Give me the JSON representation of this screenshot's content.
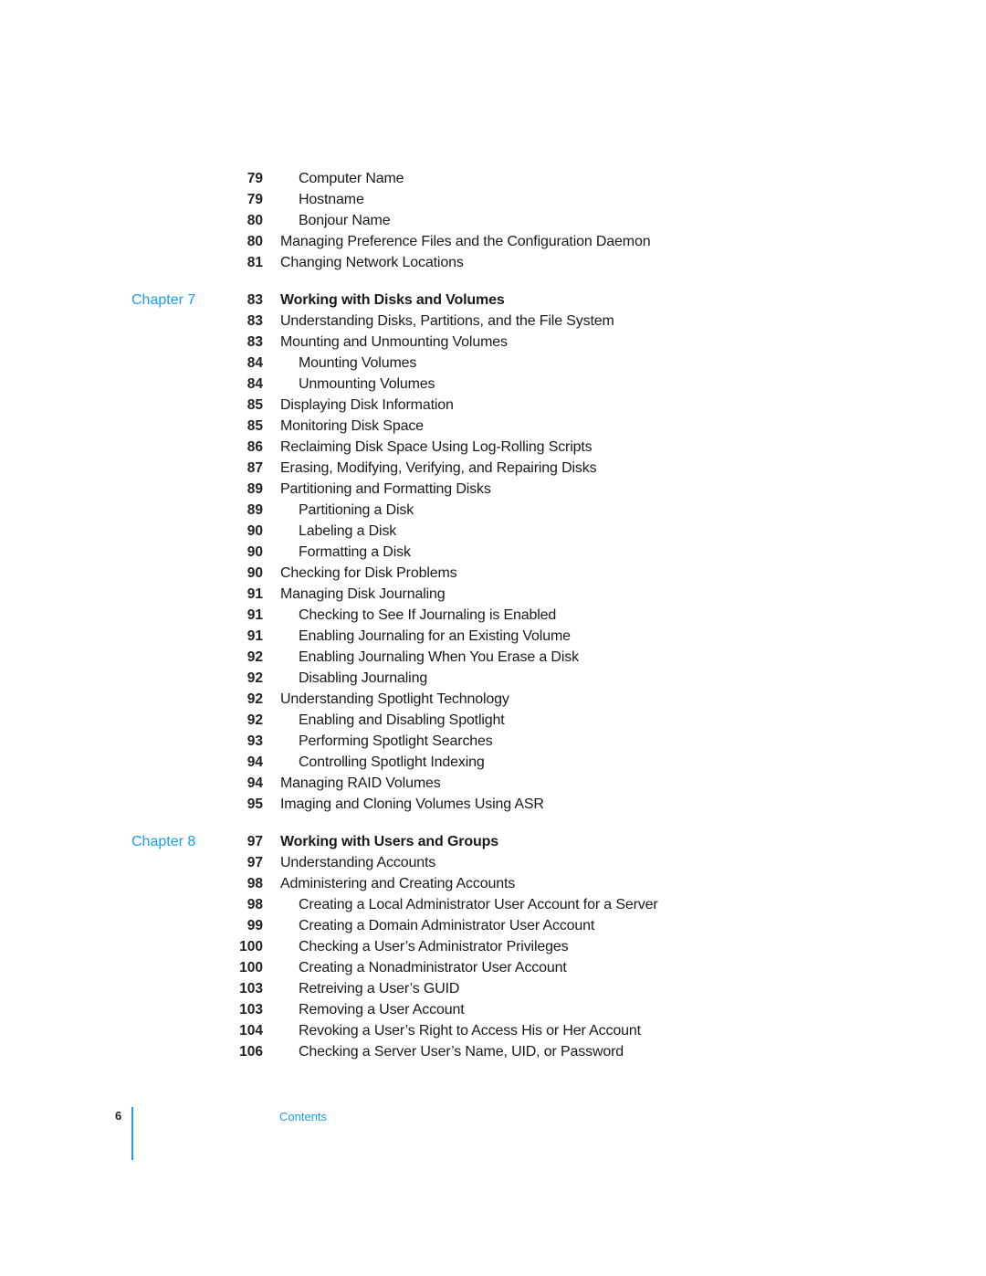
{
  "toc": {
    "entries": [
      {
        "page": "79",
        "title": "Computer Name",
        "level": 2
      },
      {
        "page": "79",
        "title": "Hostname",
        "level": 2
      },
      {
        "page": "80",
        "title": "Bonjour Name",
        "level": 2
      },
      {
        "page": "80",
        "title": "Managing Preference Files and the Configuration Daemon",
        "level": 1
      },
      {
        "page": "81",
        "title": "Changing Network Locations",
        "level": 1
      },
      {
        "chapter": "Chapter 7",
        "page": "83",
        "title": "Working with Disks and Volumes",
        "level": 0
      },
      {
        "page": "83",
        "title": "Understanding Disks, Partitions, and the File System",
        "level": 1
      },
      {
        "page": "83",
        "title": "Mounting and Unmounting Volumes",
        "level": 1
      },
      {
        "page": "84",
        "title": "Mounting Volumes",
        "level": 2
      },
      {
        "page": "84",
        "title": "Unmounting Volumes",
        "level": 2
      },
      {
        "page": "85",
        "title": "Displaying Disk Information",
        "level": 1
      },
      {
        "page": "85",
        "title": "Monitoring Disk Space",
        "level": 1
      },
      {
        "page": "86",
        "title": "Reclaiming Disk Space Using Log-Rolling Scripts",
        "level": 1
      },
      {
        "page": "87",
        "title": "Erasing, Modifying, Verifying, and Repairing Disks",
        "level": 1
      },
      {
        "page": "89",
        "title": "Partitioning and Formatting Disks",
        "level": 1
      },
      {
        "page": "89",
        "title": "Partitioning a Disk",
        "level": 2
      },
      {
        "page": "90",
        "title": "Labeling a Disk",
        "level": 2
      },
      {
        "page": "90",
        "title": "Formatting a Disk",
        "level": 2
      },
      {
        "page": "90",
        "title": "Checking for Disk Problems",
        "level": 1
      },
      {
        "page": "91",
        "title": "Managing Disk Journaling",
        "level": 1
      },
      {
        "page": "91",
        "title": "Checking to See If Journaling is Enabled",
        "level": 2
      },
      {
        "page": "91",
        "title": "Enabling Journaling for an Existing Volume",
        "level": 2
      },
      {
        "page": "92",
        "title": "Enabling Journaling When You Erase a Disk",
        "level": 2
      },
      {
        "page": "92",
        "title": "Disabling Journaling",
        "level": 2
      },
      {
        "page": "92",
        "title": "Understanding Spotlight Technology",
        "level": 1
      },
      {
        "page": "92",
        "title": "Enabling and Disabling Spotlight",
        "level": 2
      },
      {
        "page": "93",
        "title": "Performing Spotlight Searches",
        "level": 2
      },
      {
        "page": "94",
        "title": "Controlling Spotlight Indexing",
        "level": 2
      },
      {
        "page": "94",
        "title": "Managing RAID Volumes",
        "level": 1
      },
      {
        "page": "95",
        "title": "Imaging and Cloning Volumes Using ASR",
        "level": 1
      },
      {
        "chapter": "Chapter 8",
        "page": "97",
        "title": "Working with Users and Groups",
        "level": 0
      },
      {
        "page": "97",
        "title": "Understanding Accounts",
        "level": 1
      },
      {
        "page": "98",
        "title": "Administering and Creating Accounts",
        "level": 1
      },
      {
        "page": "98",
        "title": "Creating a Local Administrator User Account for a Server",
        "level": 2
      },
      {
        "page": "99",
        "title": "Creating a Domain Administrator User Account",
        "level": 2
      },
      {
        "page": "100",
        "title": "Checking a User’s Administrator Privileges",
        "level": 2
      },
      {
        "page": "100",
        "title": "Creating a Nonadministrator User Account",
        "level": 2
      },
      {
        "page": "103",
        "title": "Retreiving a User’s GUID",
        "level": 2
      },
      {
        "page": "103",
        "title": "Removing a User Account",
        "level": 2
      },
      {
        "page": "104",
        "title": "Revoking a User’s Right to Access His or Her Account",
        "level": 2
      },
      {
        "page": "106",
        "title": "Checking a Server User’s Name, UID, or Password",
        "level": 2
      }
    ]
  },
  "footer": {
    "page_number": "6",
    "section_label": "Contents"
  },
  "colors": {
    "accent": "#1a9cf0",
    "text": "#1a1a1a"
  }
}
